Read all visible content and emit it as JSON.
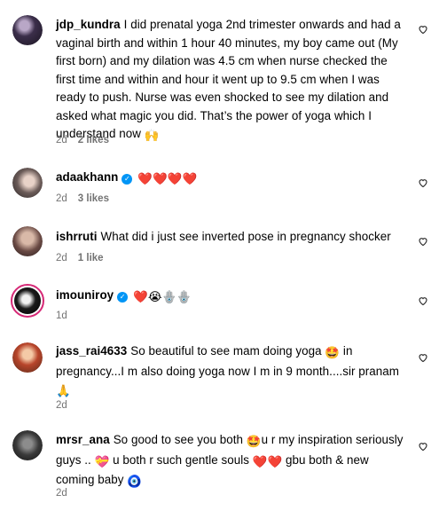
{
  "comments": [
    {
      "username": "jdp_kundra",
      "text": "I did prenatal yoga 2nd trimester onwards and had a vaginal birth and within 1 hour 40 minutes, my boy came out (My first born) and my dilation was 4.5 cm when nurse checked the first time and within and hour it went up to 9.5 cm when I was ready to push. Nurse was even shocked to see my dilation and asked what magic you did. That’s the power of yoga which I understand now",
      "emoji_tail": "🙌",
      "time": "2d",
      "likes": "2 likes"
    },
    {
      "username": "adaakhann",
      "verified": true,
      "text": "",
      "emoji_tail": "❤️❤️❤️❤️",
      "time": "2d",
      "likes": "3 likes"
    },
    {
      "username": "ishrruti",
      "text": "What did i just see inverted pose in pregnancy shocker",
      "time": "2d",
      "likes": "1 like"
    },
    {
      "username": "imouniroy",
      "verified": true,
      "text": "",
      "emoji_tail": "❤️😭🪬🪬",
      "time": "1d",
      "likes": ""
    },
    {
      "username": "jass_rai4633",
      "text_before": "So beautiful to see mam doing yoga",
      "emoji_mid": "🤩",
      "text_after": "in pregnancy...I m also doing yoga now I m in 9 month....sir pranam",
      "emoji_tail": "🙏",
      "time": "2d",
      "likes": ""
    },
    {
      "username": "mrsr_ana",
      "text_a": "So good to see you both",
      "emoji_a": "🤩",
      "text_b": "u r my inspiration seriously guys ..",
      "emoji_b": "💝",
      "text_c": "u both r such gentle souls",
      "emoji_c": "❤️❤️",
      "text_d": "gbu both & new coming baby",
      "emoji_d": "🧿",
      "time": "2d",
      "likes": ""
    }
  ],
  "icons": {
    "like": "heart-outline-icon",
    "verified": "verified-badge-icon"
  },
  "colors": {
    "meta": "#737373",
    "verified": "#0095f6",
    "heart_red": "#ed1c24"
  }
}
